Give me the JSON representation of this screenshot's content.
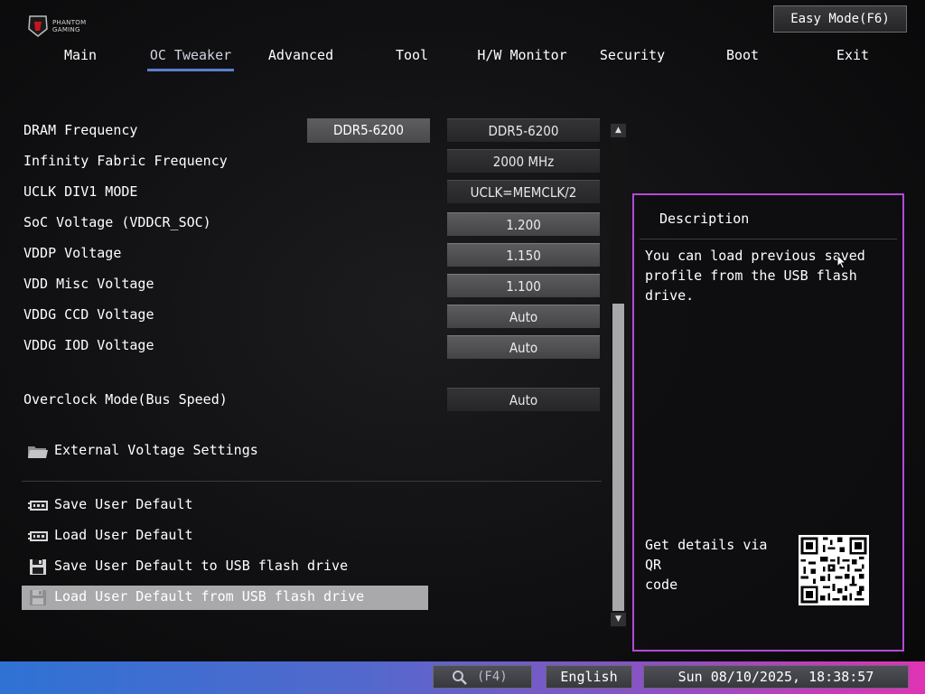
{
  "header": {
    "logo_text_line1": "PHANTOM",
    "logo_text_line2": "GAMING",
    "easy_mode_label": "Easy Mode(F6)"
  },
  "nav": {
    "tabs": [
      {
        "label": "Main"
      },
      {
        "label": "OC Tweaker"
      },
      {
        "label": "Advanced"
      },
      {
        "label": "Tool"
      },
      {
        "label": "H/W Monitor"
      },
      {
        "label": "Security"
      },
      {
        "label": "Boot"
      },
      {
        "label": "Exit"
      }
    ],
    "active_tab": "OC Tweaker"
  },
  "settings": [
    {
      "label": "DRAM Frequency",
      "current": "DDR5-6200",
      "value": "DDR5-6200"
    },
    {
      "label": "Infinity Fabric Frequency",
      "value": "2000 MHz"
    },
    {
      "label": "UCLK DIV1 MODE",
      "value": "UCLK=MEMCLK/2"
    },
    {
      "label": "SoC Voltage (VDDCR_SOC)",
      "value": "1.200"
    },
    {
      "label": "VDDP Voltage",
      "value": "1.150"
    },
    {
      "label": "VDD Misc Voltage",
      "value": "1.100"
    },
    {
      "label": "VDDG CCD Voltage",
      "value": "Auto"
    },
    {
      "label": "VDDG IOD Voltage",
      "value": "Auto"
    },
    {
      "label": "Overclock Mode(Bus Speed)",
      "value": "Auto"
    }
  ],
  "submenu": {
    "label": "External Voltage Settings"
  },
  "actions": [
    {
      "label": "Save User Default",
      "icon": "bios-chip-icon"
    },
    {
      "label": "Load User Default",
      "icon": "bios-chip-icon"
    },
    {
      "label": "Save User Default to USB flash drive",
      "icon": "floppy-disk-icon"
    },
    {
      "label": "Load User Default from USB flash drive",
      "icon": "floppy-disk-icon",
      "selected": true
    }
  ],
  "description": {
    "title": "Description",
    "text": "You can load previous saved\nprofile from the USB flash drive.",
    "qr_text": "Get details via QR\ncode"
  },
  "footer": {
    "search_key": "(F4)",
    "language": "English",
    "datetime": "Sun 08/10/2025, 18:38:57"
  },
  "colors": {
    "accent_underline": "#5a7fd0",
    "description_border": "#b24ad8",
    "selected_row": "#a9a9ab",
    "bottom_bar_start": "#2f72d4",
    "bottom_bar_end": "#de34b4"
  }
}
